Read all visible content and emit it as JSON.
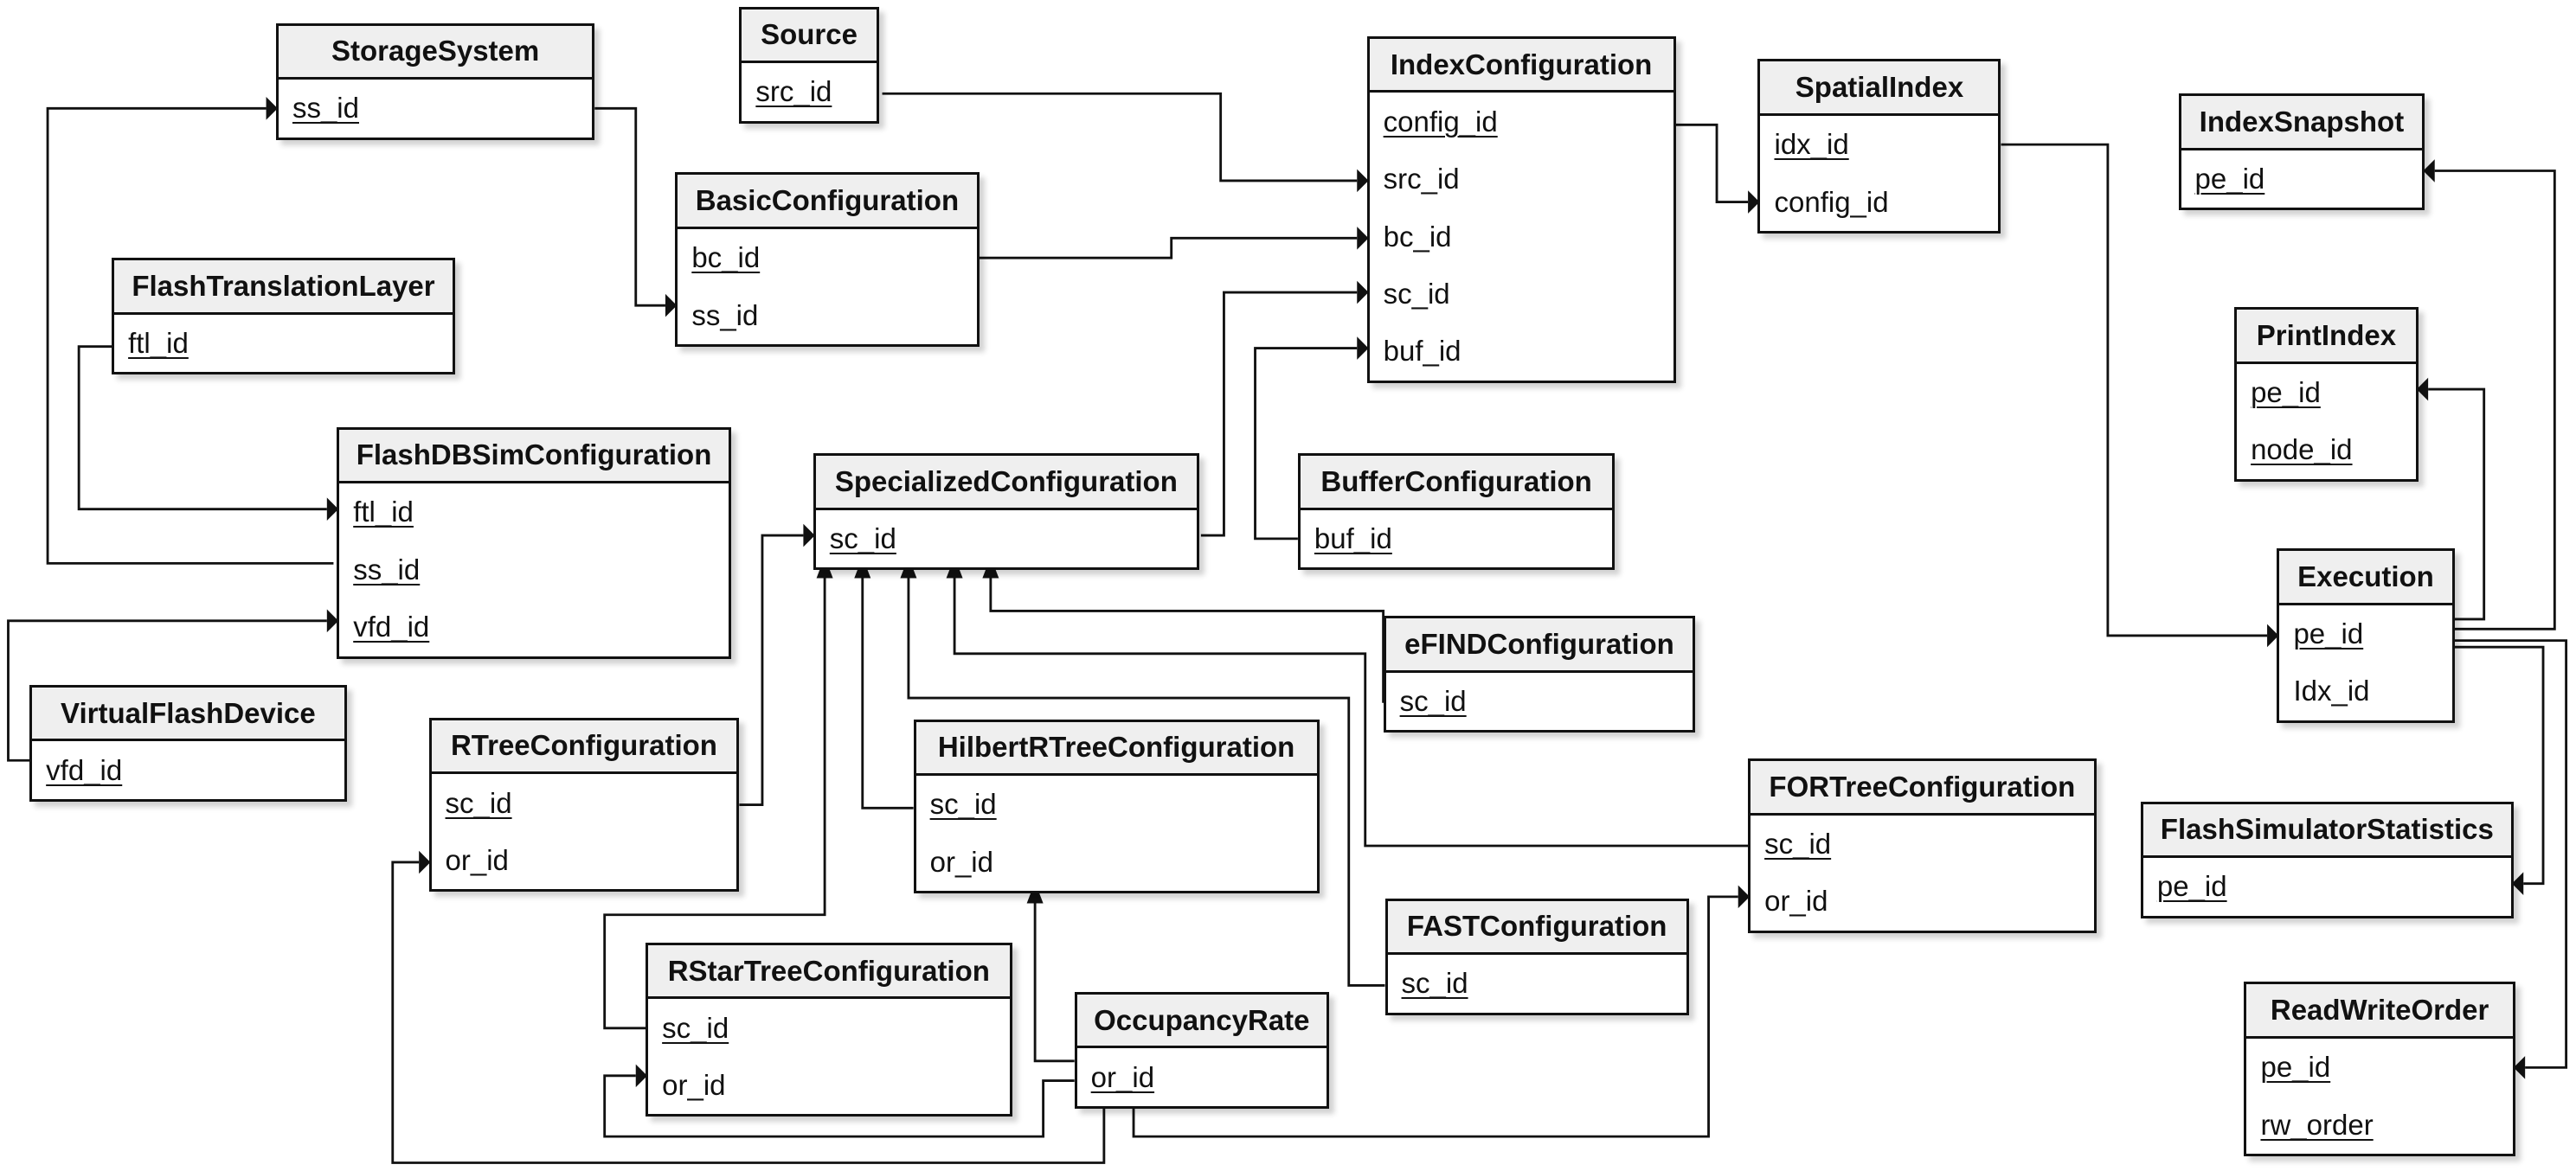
{
  "diagram": {
    "type": "entity-relationship",
    "entities": [
      {
        "id": "StorageSystem",
        "name": "StorageSystem",
        "attributes": [
          {
            "name": "ss_id",
            "pk": true
          }
        ]
      },
      {
        "id": "Source",
        "name": "Source",
        "attributes": [
          {
            "name": "src_id",
            "pk": true
          }
        ]
      },
      {
        "id": "IndexConfiguration",
        "name": "IndexConfiguration",
        "attributes": [
          {
            "name": "config_id",
            "pk": true
          },
          {
            "name": "src_id",
            "pk": false
          },
          {
            "name": "bc_id",
            "pk": false
          },
          {
            "name": "sc_id",
            "pk": false
          },
          {
            "name": "buf_id",
            "pk": false
          }
        ]
      },
      {
        "id": "SpatialIndex",
        "name": "SpatialIndex",
        "attributes": [
          {
            "name": "idx_id",
            "pk": true
          },
          {
            "name": "config_id",
            "pk": false
          }
        ]
      },
      {
        "id": "IndexSnapshot",
        "name": "IndexSnapshot",
        "attributes": [
          {
            "name": "pe_id",
            "pk": true
          }
        ]
      },
      {
        "id": "BasicConfiguration",
        "name": "BasicConfiguration",
        "attributes": [
          {
            "name": "bc_id",
            "pk": true
          },
          {
            "name": "ss_id",
            "pk": false
          }
        ]
      },
      {
        "id": "FlashTranslationLayer",
        "name": "FlashTranslationLayer",
        "attributes": [
          {
            "name": "ftl_id",
            "pk": true
          }
        ]
      },
      {
        "id": "FlashDBSimConfiguration",
        "name": "FlashDBSimConfiguration",
        "attributes": [
          {
            "name": "ftl_id",
            "pk": true
          },
          {
            "name": "ss_id",
            "pk": true
          },
          {
            "name": "vfd_id",
            "pk": true
          }
        ]
      },
      {
        "id": "SpecializedConfiguration",
        "name": "SpecializedConfiguration",
        "attributes": [
          {
            "name": "sc_id",
            "pk": true
          }
        ]
      },
      {
        "id": "BufferConfiguration",
        "name": "BufferConfiguration",
        "attributes": [
          {
            "name": "buf_id",
            "pk": true
          }
        ]
      },
      {
        "id": "PrintIndex",
        "name": "PrintIndex",
        "attributes": [
          {
            "name": "pe_id",
            "pk": true
          },
          {
            "name": "node_id",
            "pk": true
          }
        ]
      },
      {
        "id": "eFINDConfiguration",
        "name": "eFINDConfiguration",
        "attributes": [
          {
            "name": "sc_id",
            "pk": true
          }
        ]
      },
      {
        "id": "Execution",
        "name": "Execution",
        "attributes": [
          {
            "name": "pe_id",
            "pk": true
          },
          {
            "name": "Idx_id",
            "pk": false
          }
        ]
      },
      {
        "id": "VirtualFlashDevice",
        "name": "VirtualFlashDevice",
        "attributes": [
          {
            "name": "vfd_id",
            "pk": true
          }
        ]
      },
      {
        "id": "RTreeConfiguration",
        "name": "RTreeConfiguration",
        "attributes": [
          {
            "name": "sc_id",
            "pk": true
          },
          {
            "name": "or_id",
            "pk": false
          }
        ]
      },
      {
        "id": "HilbertRTreeConfiguration",
        "name": "HilbertRTreeConfiguration",
        "attributes": [
          {
            "name": "sc_id",
            "pk": true
          },
          {
            "name": "or_id",
            "pk": false
          }
        ]
      },
      {
        "id": "FORTreeConfiguration",
        "name": "FORTreeConfiguration",
        "attributes": [
          {
            "name": "sc_id",
            "pk": true
          },
          {
            "name": "or_id",
            "pk": false
          }
        ]
      },
      {
        "id": "FlashSimulatorStatistics",
        "name": "FlashSimulatorStatistics",
        "attributes": [
          {
            "name": "pe_id",
            "pk": true
          }
        ]
      },
      {
        "id": "FASTConfiguration",
        "name": "FASTConfiguration",
        "attributes": [
          {
            "name": "sc_id",
            "pk": true
          }
        ]
      },
      {
        "id": "RStarTreeConfiguration",
        "name": "RStarTreeConfiguration",
        "attributes": [
          {
            "name": "sc_id",
            "pk": true
          },
          {
            "name": "or_id",
            "pk": false
          }
        ]
      },
      {
        "id": "OccupancyRate",
        "name": "OccupancyRate",
        "attributes": [
          {
            "name": "or_id",
            "pk": true
          }
        ]
      },
      {
        "id": "ReadWriteOrder",
        "name": "ReadWriteOrder",
        "attributes": [
          {
            "name": "pe_id",
            "pk": true
          },
          {
            "name": "rw_order",
            "pk": true
          }
        ]
      }
    ],
    "relationships": [
      {
        "from": "StorageSystem.ss_id",
        "to": "BasicConfiguration.ss_id"
      },
      {
        "from": "FlashDBSimConfiguration.ss_id",
        "to": "StorageSystem.ss_id"
      },
      {
        "from": "FlashTranslationLayer.ftl_id",
        "to": "FlashDBSimConfiguration.ftl_id"
      },
      {
        "from": "VirtualFlashDevice.vfd_id",
        "to": "FlashDBSimConfiguration.vfd_id"
      },
      {
        "from": "Source.src_id",
        "to": "IndexConfiguration.src_id"
      },
      {
        "from": "BasicConfiguration.bc_id",
        "to": "IndexConfiguration.bc_id"
      },
      {
        "from": "SpecializedConfiguration.sc_id",
        "to": "IndexConfiguration.sc_id"
      },
      {
        "from": "BufferConfiguration.buf_id",
        "to": "IndexConfiguration.buf_id"
      },
      {
        "from": "IndexConfiguration.config_id",
        "to": "SpatialIndex.config_id"
      },
      {
        "from": "SpatialIndex.idx_id",
        "to": "Execution.pe_id"
      },
      {
        "from": "Execution.pe_id",
        "to": "IndexSnapshot.pe_id"
      },
      {
        "from": "Execution.pe_id",
        "to": "PrintIndex.pe_id"
      },
      {
        "from": "Execution.pe_id",
        "to": "FlashSimulatorStatistics.pe_id"
      },
      {
        "from": "Execution.pe_id",
        "to": "ReadWriteOrder.pe_id"
      },
      {
        "from": "RTreeConfiguration.sc_id",
        "to": "SpecializedConfiguration.sc_id"
      },
      {
        "from": "RStarTreeConfiguration.sc_id",
        "to": "SpecializedConfiguration.sc_id"
      },
      {
        "from": "HilbertRTreeConfiguration.sc_id",
        "to": "SpecializedConfiguration.sc_id"
      },
      {
        "from": "FASTConfiguration.sc_id",
        "to": "SpecializedConfiguration.sc_id"
      },
      {
        "from": "FORTreeConfiguration.sc_id",
        "to": "SpecializedConfiguration.sc_id"
      },
      {
        "from": "eFINDConfiguration.sc_id",
        "to": "SpecializedConfiguration.sc_id"
      },
      {
        "from": "OccupancyRate.or_id",
        "to": "HilbertRTreeConfiguration.or_id"
      },
      {
        "from": "OccupancyRate.or_id",
        "to": "RStarTreeConfiguration.or_id"
      },
      {
        "from": "OccupancyRate.or_id",
        "to": "RTreeConfiguration.or_id"
      },
      {
        "from": "OccupancyRate.or_id",
        "to": "FORTreeConfiguration.or_id"
      }
    ]
  }
}
